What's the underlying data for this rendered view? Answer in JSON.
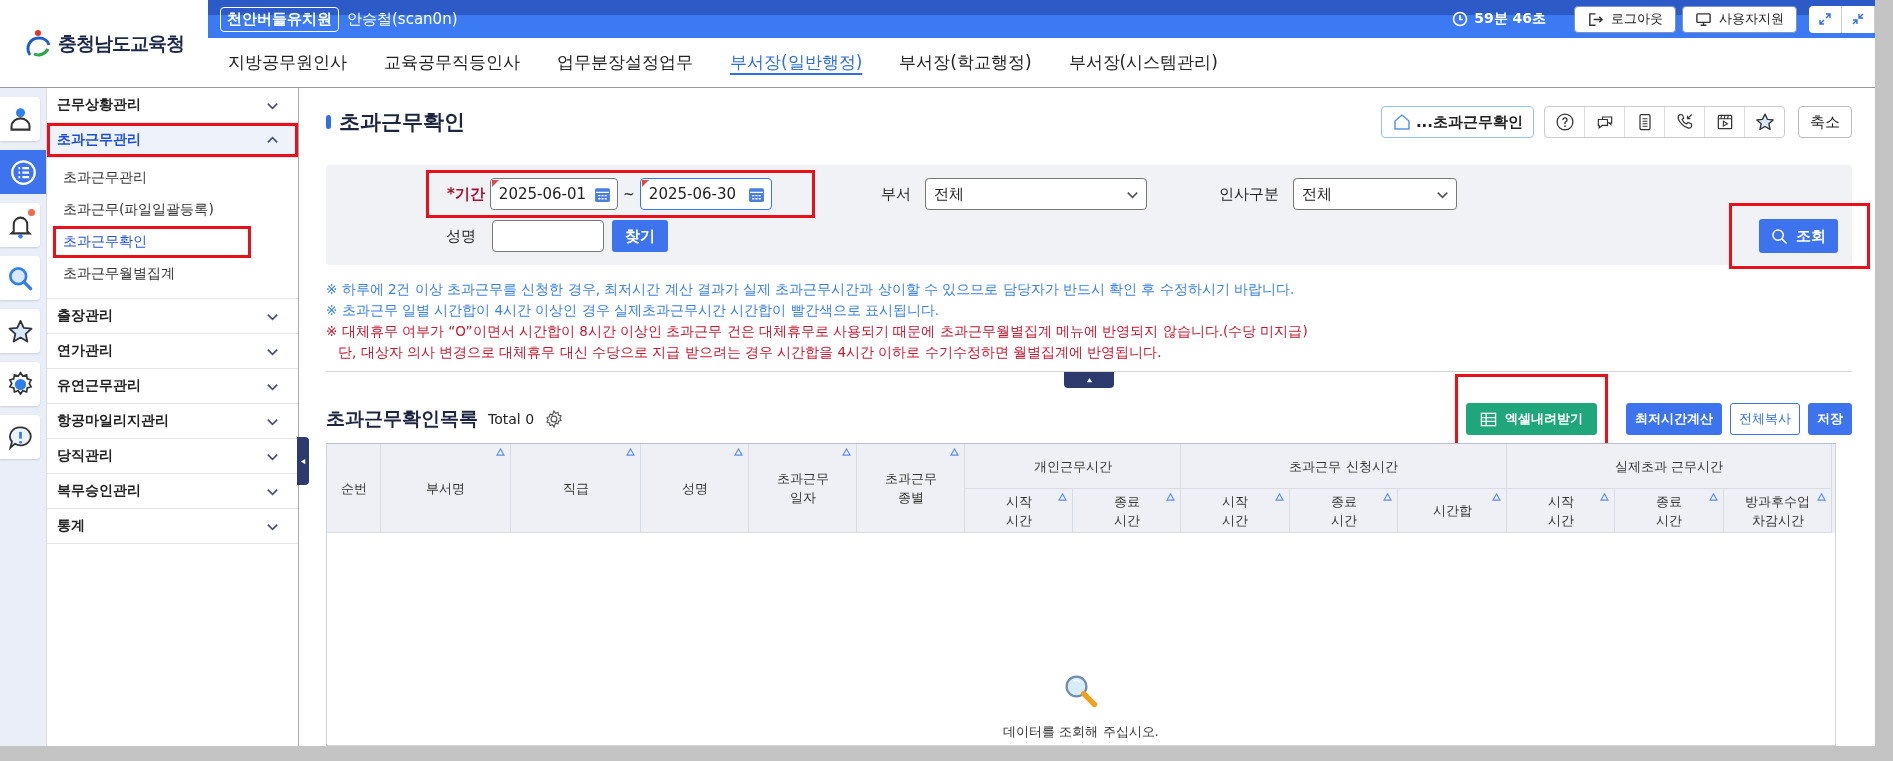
{
  "header": {
    "org_name": "충청남도교육청",
    "school": "천안버들유치원",
    "user": "안승철(scan0n)",
    "session_timer": "59분 46초",
    "buttons": [
      {
        "label": "로그아웃",
        "kind": "logout"
      },
      {
        "label": "사용자지원",
        "kind": "support"
      }
    ]
  },
  "nav_tabs": [
    {
      "label": "지방공무원인사",
      "selected": false
    },
    {
      "label": "교육공무직등인사",
      "selected": false
    },
    {
      "label": "업무분장설정업무",
      "selected": false
    },
    {
      "label": "부서장(일반행정)",
      "selected": true
    },
    {
      "label": "부서장(학교행정)",
      "selected": false
    },
    {
      "label": "부서장(시스템관리)",
      "selected": false
    }
  ],
  "rail": [
    {
      "kind": "person",
      "selected": false,
      "badge": false
    },
    {
      "kind": "list",
      "selected": true,
      "badge": false
    },
    {
      "kind": "bell",
      "selected": false,
      "badge": true
    },
    {
      "kind": "search",
      "selected": false,
      "badge": false
    },
    {
      "kind": "star",
      "selected": false,
      "badge": false
    },
    {
      "kind": "gear",
      "selected": false,
      "badge": false
    },
    {
      "kind": "alert",
      "selected": false,
      "badge": false
    }
  ],
  "sidebar": [
    {
      "label": "근무상황관리",
      "expanded": false,
      "highlighted": false
    },
    {
      "label": "초과근무관리",
      "expanded": true,
      "highlighted": true,
      "children": [
        {
          "label": "초과근무관리",
          "selected": false,
          "highlighted": false
        },
        {
          "label": "초과근무(파일일괄등록)",
          "selected": false,
          "highlighted": false
        },
        {
          "label": "초과근무확인",
          "selected": true,
          "highlighted": true
        },
        {
          "label": "초과근무월별집계",
          "selected": false,
          "highlighted": false
        }
      ]
    },
    {
      "label": "출장관리",
      "expanded": false,
      "highlighted": false
    },
    {
      "label": "연가관리",
      "expanded": false,
      "highlighted": false
    },
    {
      "label": "유연근무관리",
      "expanded": false,
      "highlighted": false
    },
    {
      "label": "항공마일리지관리",
      "expanded": false,
      "highlighted": false
    },
    {
      "label": "당직관리",
      "expanded": false,
      "highlighted": false
    },
    {
      "label": "복무승인관리",
      "expanded": false,
      "highlighted": false
    },
    {
      "label": "통계",
      "expanded": false,
      "highlighted": false
    }
  ],
  "page": {
    "title": "초과근무확인",
    "breadcrumb": "...초과근무확인",
    "tools": [
      {
        "kind": "help"
      },
      {
        "kind": "chat"
      },
      {
        "kind": "document"
      },
      {
        "kind": "phone"
      },
      {
        "kind": "video"
      },
      {
        "kind": "star"
      }
    ],
    "collapse_button": "축소"
  },
  "filters": {
    "period": {
      "label": "*기간",
      "from": {
        "value": "2025-06-01",
        "focused": false
      },
      "separator": "~",
      "to": {
        "value": "2025-06-30",
        "focused": true
      },
      "highlighted": true
    },
    "department": {
      "label": "부서",
      "value": "전체"
    },
    "personnel_type": {
      "label": "인사구분",
      "value": "전체"
    },
    "name": {
      "label": "성명"
    },
    "find_button": "찾기",
    "search_button": {
      "label": "조회",
      "highlighted": true
    }
  },
  "notes": [
    {
      "text": "※ 하루에 2건 이상 초과근무를 신청한 경우, 최저시간 계산 결과가 실제 초과근무시간과 상이할 수 있으므로 담당자가 반드시 확인 후 수정하시기 바랍니다.",
      "color": "#3b82e6",
      "indented": false
    },
    {
      "text": "※ 초과근무 일별 시간합이 4시간 이상인 경우 실제초과근무시간 시간합이 빨간색으로 표시됩니다.",
      "color": "#3b82e6",
      "indented": false
    },
    {
      "text": "※ 대체휴무 여부가 “O”이면서 시간합이 8시간 이상인 초과근무 건은 대체휴무로 사용되기 때문에 초과근무월별집계 메뉴에 반영되지 않습니다.(수당 미지급)",
      "color": "#c8172f",
      "indented": false
    },
    {
      "text": "단, 대상자 의사 변경으로 대체휴무 대신 수당으로 지급 받으려는 경우 시간합을 4시간 이하로 수기수정하면 월별집계에 반영됩니다.",
      "color": "#c8172f",
      "indented": true
    }
  ],
  "list": {
    "title": "초과근무확인목록",
    "total": "Total 0",
    "buttons": [
      {
        "label": "엑셀내려받기",
        "kind": "excel",
        "highlighted": true
      },
      {
        "label": "최저시간계산",
        "kind": "primary",
        "highlighted": false
      },
      {
        "label": "전체복사",
        "kind": "outline",
        "highlighted": false
      },
      {
        "label": "저장",
        "kind": "primary",
        "highlighted": false
      }
    ]
  },
  "table": {
    "columns": [
      {
        "label": "순번",
        "sortable": false
      },
      {
        "label": "부서명",
        "sortable": true
      },
      {
        "label": "직급",
        "sortable": true
      },
      {
        "label": "성명",
        "sortable": true
      },
      {
        "label": "초과근무\n일자",
        "sortable": true
      },
      {
        "label": "초과근무\n종별",
        "sortable": true
      },
      {
        "label": "개인근무시간",
        "children": [
          {
            "label": "시작\n시간",
            "sortable": true
          },
          {
            "label": "종료\n시간",
            "sortable": true
          }
        ]
      },
      {
        "label": "초과근무 신청시간",
        "children": [
          {
            "label": "시작\n시간",
            "sortable": true
          },
          {
            "label": "종료\n시간",
            "sortable": true
          },
          {
            "label": "시간합",
            "sortable": true
          }
        ]
      },
      {
        "label": "실제초과 근무시간",
        "children": [
          {
            "label": "시작\n시간",
            "sortable": true
          },
          {
            "label": "종료\n시간",
            "sortable": true
          },
          {
            "label": "방과후수업\n차감시간",
            "sortable": true
          }
        ]
      }
    ],
    "empty_message": "데이터를 조회해 주십시오."
  }
}
